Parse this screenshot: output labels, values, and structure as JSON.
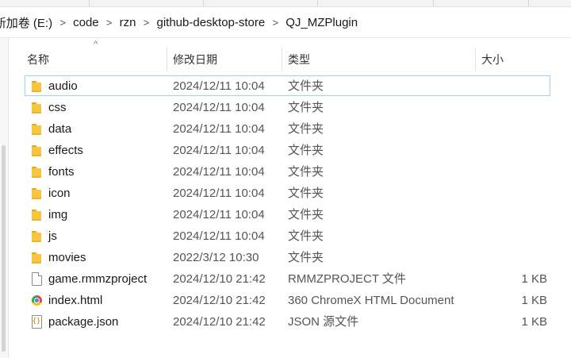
{
  "breadcrumb": [
    "新加卷 (E:)",
    "code",
    "rzn",
    "github-desktop-store",
    "QJ_MZPlugin"
  ],
  "columns": {
    "name": "名称",
    "date": "修改日期",
    "type": "类型",
    "size": "大小"
  },
  "rows": [
    {
      "name": "audio",
      "date": "2024/12/11 10:04",
      "type": "文件夹",
      "size": "",
      "icon": "folder-icon"
    },
    {
      "name": "css",
      "date": "2024/12/11 10:04",
      "type": "文件夹",
      "size": "",
      "icon": "folder-icon"
    },
    {
      "name": "data",
      "date": "2024/12/11 10:04",
      "type": "文件夹",
      "size": "",
      "icon": "folder-icon"
    },
    {
      "name": "effects",
      "date": "2024/12/11 10:04",
      "type": "文件夹",
      "size": "",
      "icon": "folder-icon"
    },
    {
      "name": "fonts",
      "date": "2024/12/11 10:04",
      "type": "文件夹",
      "size": "",
      "icon": "folder-icon"
    },
    {
      "name": "icon",
      "date": "2024/12/11 10:04",
      "type": "文件夹",
      "size": "",
      "icon": "folder-icon"
    },
    {
      "name": "img",
      "date": "2024/12/11 10:04",
      "type": "文件夹",
      "size": "",
      "icon": "folder-icon"
    },
    {
      "name": "js",
      "date": "2024/12/11 10:04",
      "type": "文件夹",
      "size": "",
      "icon": "folder-icon"
    },
    {
      "name": "movies",
      "date": "2022/3/12 10:30",
      "type": "文件夹",
      "size": "",
      "icon": "folder-icon"
    },
    {
      "name": "game.rmmzproject",
      "date": "2024/12/10 21:42",
      "type": "RMMZPROJECT 文件",
      "size": "1 KB",
      "icon": "file-icon"
    },
    {
      "name": "index.html",
      "date": "2024/12/10 21:42",
      "type": "360 ChromeX HTML Document",
      "size": "1 KB",
      "icon": "chrome-icon"
    },
    {
      "name": "package.json",
      "date": "2024/12/10 21:42",
      "type": "JSON 源文件",
      "size": "1 KB",
      "icon": "json-file-icon"
    }
  ],
  "colors": {
    "folder": "#f8c543",
    "selection_border": "#99d1ff"
  }
}
